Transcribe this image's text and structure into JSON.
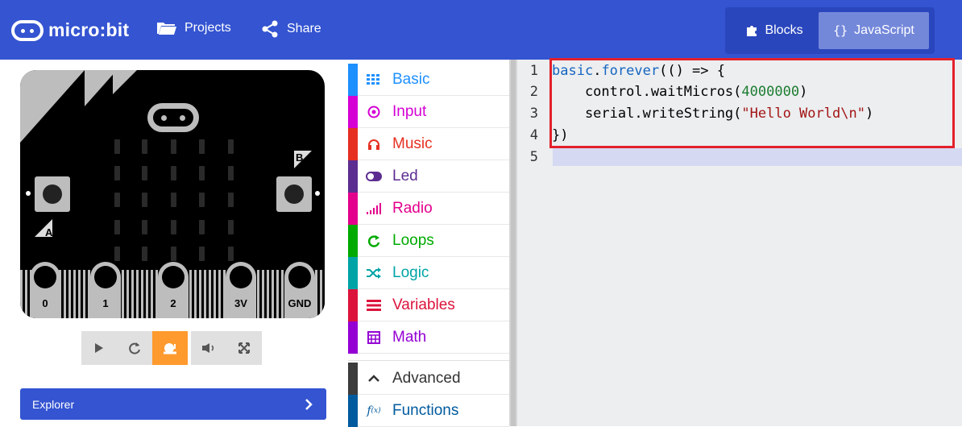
{
  "header": {
    "brand": "micro:bit",
    "projects_label": "Projects",
    "share_label": "Share",
    "blocks_label": "Blocks",
    "javascript_label": "JavaScript",
    "active_mode": "JavaScript",
    "colors": {
      "bar": "#3454D1",
      "toggle_active": "#7488DA"
    }
  },
  "simulator": {
    "button_a_label": "A",
    "button_b_label": "B",
    "pins": [
      "0",
      "1",
      "2",
      "3V",
      "GND"
    ],
    "controls": [
      {
        "name": "play",
        "icon": "play-icon"
      },
      {
        "name": "restart",
        "icon": "restart-icon"
      },
      {
        "name": "slow-mo",
        "icon": "snail-icon",
        "active": true
      },
      {
        "name": "mute",
        "icon": "speaker-icon"
      },
      {
        "name": "fullscreen",
        "icon": "fullscreen-icon"
      }
    ],
    "explorer_label": "Explorer"
  },
  "toolbox": {
    "categories": [
      {
        "label": "Basic",
        "color": "#1E90FF",
        "icon": "grid-icon"
      },
      {
        "label": "Input",
        "color": "#D400D4",
        "icon": "target-icon"
      },
      {
        "label": "Music",
        "color": "#E63022",
        "icon": "headphones-icon"
      },
      {
        "label": "Led",
        "color": "#5C2D91",
        "icon": "toggle-icon"
      },
      {
        "label": "Radio",
        "color": "#E3008C",
        "icon": "signal-icon"
      },
      {
        "label": "Loops",
        "color": "#00AA00",
        "icon": "loop-icon"
      },
      {
        "label": "Logic",
        "color": "#00A4A6",
        "icon": "shuffle-icon"
      },
      {
        "label": "Variables",
        "color": "#DC143C",
        "icon": "list-icon"
      },
      {
        "label": "Math",
        "color": "#9400D3",
        "icon": "calculator-icon"
      }
    ],
    "advanced": [
      {
        "label": "Advanced",
        "color": "#3C3C3C",
        "icon": "chevron-up-icon"
      },
      {
        "label": "Functions",
        "color": "#005A9E",
        "icon": "function-icon"
      }
    ]
  },
  "editor": {
    "line_numbers": [
      "1",
      "2",
      "3",
      "4",
      "5"
    ],
    "lines": {
      "l1_obj": "basic",
      "l1_dot": ".",
      "l1_fn": "forever",
      "l1_rest": "(() => {",
      "l2_prefix": "    control.waitMicros(",
      "l2_num": "4000000",
      "l2_suffix": ")",
      "l3_prefix": "    serial.writeString(",
      "l3_str": "\"Hello World\\n\"",
      "l3_suffix": ")",
      "l4": "})"
    }
  }
}
